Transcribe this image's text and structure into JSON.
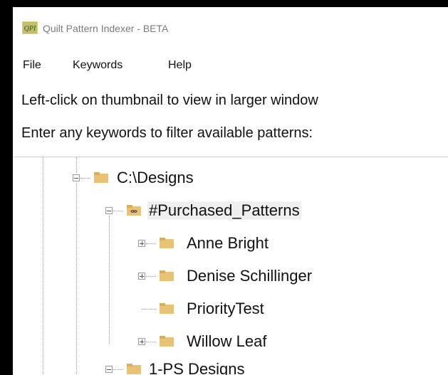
{
  "window": {
    "title": "Quilt Pattern Indexer - BETA",
    "icon": "qpi-app-icon"
  },
  "menu": {
    "items": [
      "File",
      "Keywords",
      "Help"
    ]
  },
  "instructions": {
    "line1": "Left-click on thumbnail to view in larger window",
    "line2": "Enter any keywords to filter available patterns:"
  },
  "tree": {
    "nodes": [
      {
        "label": "C:\\Designs",
        "level": 0,
        "expanded": true,
        "icon": "folder-icon"
      },
      {
        "label": "#Purchased_Patterns",
        "level": 1,
        "expanded": true,
        "icon": "shared-folder-icon",
        "selected": true
      },
      {
        "label": "Anne Bright",
        "level": 2,
        "expanded": false,
        "icon": "folder-icon"
      },
      {
        "label": "Denise Schillinger",
        "level": 2,
        "expanded": false,
        "icon": "folder-icon"
      },
      {
        "label": "PriorityTest",
        "level": 2,
        "leaf": true,
        "icon": "folder-icon"
      },
      {
        "label": "Willow Leaf",
        "level": 2,
        "expanded": false,
        "icon": "folder-icon"
      },
      {
        "label": "1-PS Designs",
        "level": 1,
        "expanded": true,
        "icon": "folder-icon"
      }
    ]
  },
  "colors": {
    "folder": "#e8c275",
    "folder_tab": "#d9ae5c",
    "selection": "#efefef",
    "title_text": "#7a7a7a"
  }
}
